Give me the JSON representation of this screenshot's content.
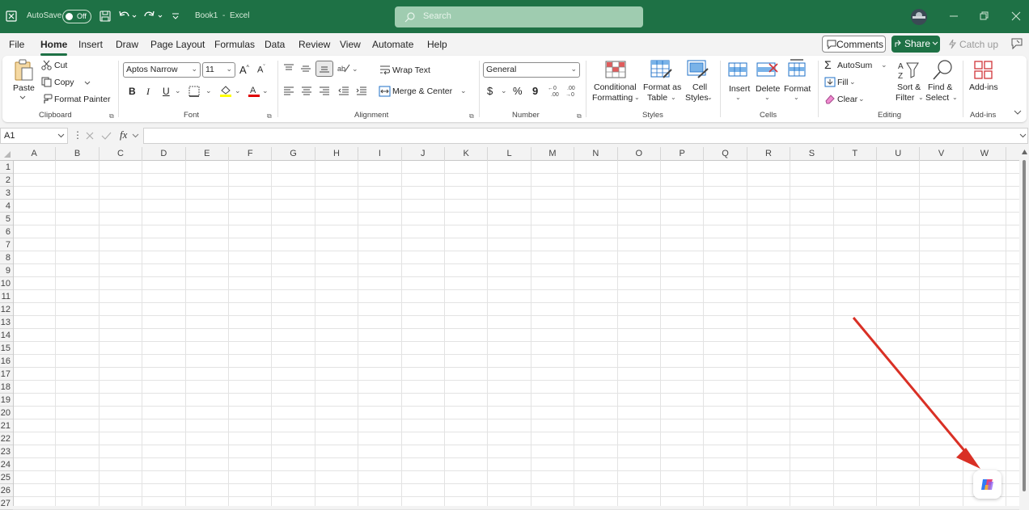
{
  "titlebar": {
    "autosave_label": "AutoSave",
    "autosave_state": "Off",
    "doc_title": "Book1",
    "app_name": "Excel",
    "title_sep": "-",
    "search_placeholder": "Search"
  },
  "menus": [
    "File",
    "Home",
    "Insert",
    "Draw",
    "Page Layout",
    "Formulas",
    "Data",
    "Review",
    "View",
    "Automate",
    "Help"
  ],
  "menu_actions": {
    "comments": "Comments",
    "share": "Share",
    "catch_up": "Catch up"
  },
  "ribbon": {
    "clipboard": {
      "paste": "Paste",
      "cut": "Cut",
      "copy": "Copy",
      "format_painter": "Format Painter",
      "group": "Clipboard"
    },
    "font": {
      "family": "Aptos Narrow",
      "size": "11",
      "bold": "B",
      "italic": "I",
      "underline": "U",
      "group": "Font"
    },
    "alignment": {
      "wrap_text": "Wrap Text",
      "merge_center": "Merge & Center",
      "group": "Alignment"
    },
    "number": {
      "format": "General",
      "currency": "$",
      "percent": "%",
      "comma": "9",
      "group": "Number"
    },
    "styles": {
      "conditional_1": "Conditional",
      "conditional_2": "Formatting",
      "format_as_1": "Format as",
      "format_as_2": "Table",
      "cell_styles_1": "Cell",
      "cell_styles_2": "Styles",
      "group": "Styles"
    },
    "cells": {
      "insert": "Insert",
      "delete": "Delete",
      "format": "Format",
      "group": "Cells"
    },
    "editing": {
      "autosum": "AutoSum",
      "fill": "Fill",
      "clear": "Clear",
      "sort_1": "Sort &",
      "sort_2": "Filter",
      "find_1": "Find &",
      "find_2": "Select",
      "group": "Editing"
    },
    "addins": {
      "addins": "Add-ins",
      "group": "Add-ins"
    }
  },
  "formula_bar": {
    "name_box": "A1",
    "fx": "fx"
  },
  "columns": [
    "A",
    "B",
    "C",
    "D",
    "E",
    "F",
    "G",
    "H",
    "I",
    "J",
    "K",
    "L",
    "M",
    "N",
    "O",
    "P",
    "Q",
    "R",
    "S",
    "T",
    "U",
    "V",
    "W"
  ],
  "rows": [
    "1",
    "2",
    "3",
    "4",
    "5",
    "6",
    "7",
    "8",
    "9",
    "10",
    "11",
    "12",
    "13",
    "14",
    "15",
    "16",
    "17",
    "18",
    "19",
    "20",
    "21",
    "22",
    "23",
    "24",
    "25",
    "26",
    "27"
  ],
  "colors": {
    "brand": "#1e7145",
    "arrow": "#d93025"
  }
}
